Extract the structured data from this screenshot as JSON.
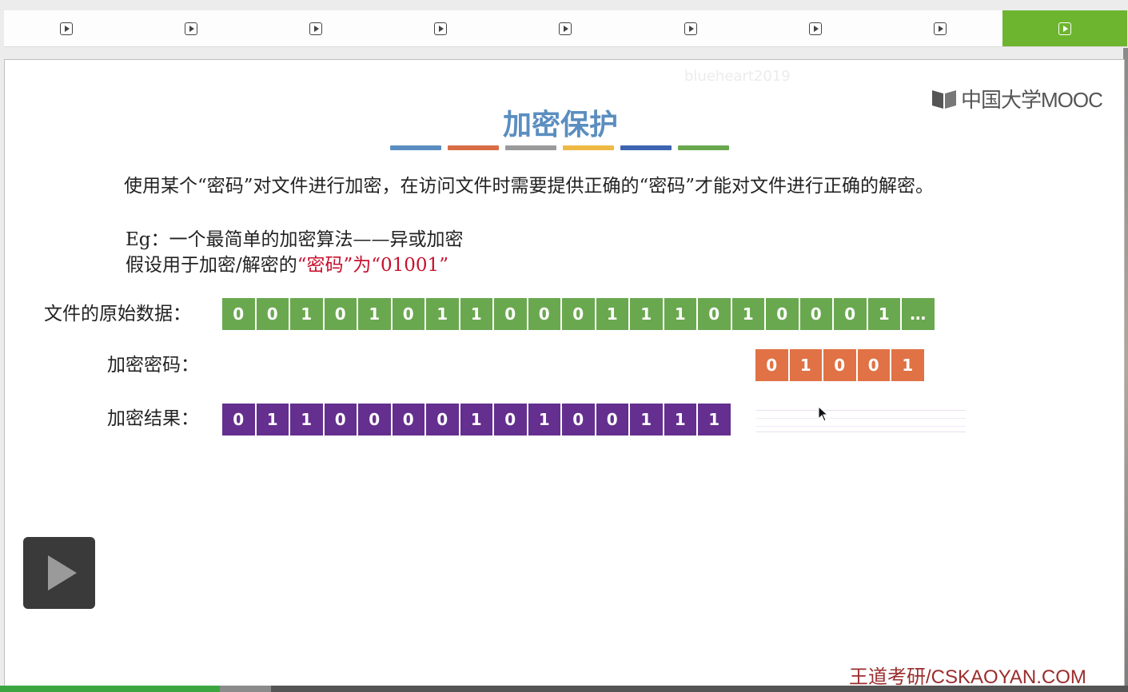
{
  "chapter_bar": {
    "segment_count": 9,
    "active_index": 8,
    "icon": "play-icon",
    "active_color": "#6db52f"
  },
  "slide": {
    "watermark_user": "blueheart2019",
    "logo_text": "中国大学MOOC",
    "title": "加密保护",
    "title_bar_colors": [
      "#5b8ec0",
      "#d96d45",
      "#9a9a9a",
      "#efb945",
      "#3d64b0",
      "#6aa84f"
    ],
    "intro": "使用某个“密码”对文件进行加密，在访问文件时需要提供正确的“密码”才能对文件进行正确的解密。",
    "eg_line": "Eg：一个最简单的加密算法——异或加密",
    "assume_prefix": "假设用于加密/解密的",
    "assume_red": "“密码”为“01001”",
    "rows": [
      {
        "label": "文件的原始数据：",
        "color": "#6aa84f",
        "bits": [
          "0",
          "0",
          "1",
          "0",
          "1",
          "0",
          "1",
          "1",
          "0",
          "0",
          "0",
          "1",
          "1",
          "1",
          "0",
          "1",
          "0",
          "0",
          "0",
          "1",
          "…"
        ]
      },
      {
        "label": "加密密码：",
        "color": "#e07245",
        "bits": [
          "0",
          "1",
          "0",
          "0",
          "1"
        ]
      },
      {
        "label": "加密结果：",
        "color": "#642f8f",
        "bits": [
          "0",
          "1",
          "1",
          "0",
          "0",
          "0",
          "0",
          "1",
          "0",
          "1",
          "0",
          "0",
          "1",
          "1",
          "1"
        ]
      }
    ],
    "footer_brand": "王道考研/CSKAOYAN.COM"
  },
  "player": {
    "play_icon": "play-icon",
    "progress_played_pct": 19.5,
    "progress_buffered_pct": 24
  }
}
